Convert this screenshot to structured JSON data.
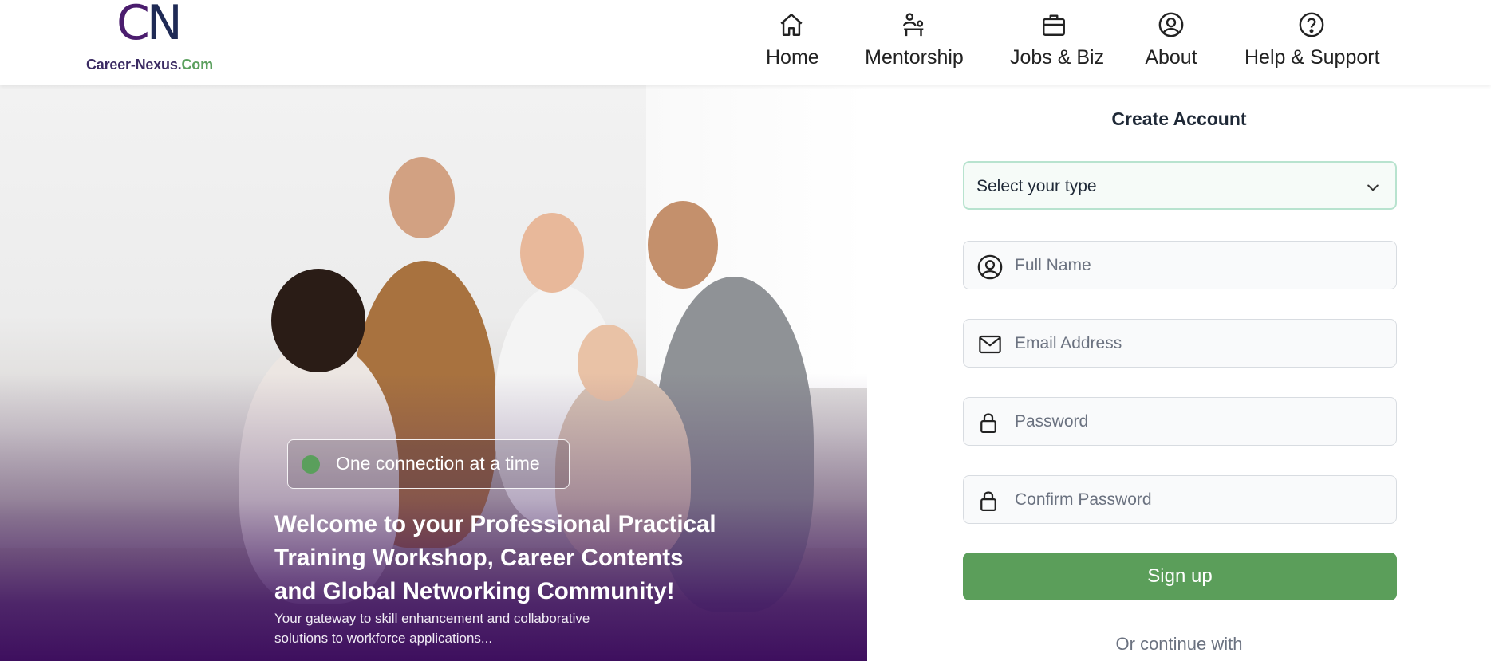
{
  "logo": {
    "mark_c": "C",
    "mark_n": "N",
    "name_main": "Career-Nexus.",
    "name_suffix": "Com"
  },
  "nav": [
    {
      "label": "Home",
      "icon": "home-icon"
    },
    {
      "label": "Mentorship",
      "icon": "mentorship-icon"
    },
    {
      "label": "Jobs & Biz",
      "icon": "briefcase-icon"
    },
    {
      "label": "About",
      "icon": "user-circle-icon"
    },
    {
      "label": "Help & Support",
      "icon": "question-icon"
    }
  ],
  "hero": {
    "tagline": "One connection at a time",
    "title": "Welcome to your Professional Practical Training Workshop, Career Contents and Global Networking Community!",
    "subtitle": "Your gateway to skill enhancement and collaborative solutions to workforce applications..."
  },
  "form": {
    "title": "Create Account",
    "type_select": "Select your type",
    "full_name_placeholder": "Full Name",
    "email_placeholder": "Email Address",
    "password_placeholder": "Password",
    "confirm_password_placeholder": "Confirm Password",
    "signup_label": "Sign up",
    "continue_label": "Or continue with"
  },
  "colors": {
    "brand_green": "#5b9e5a",
    "brand_purple": "#4b1d6e"
  }
}
